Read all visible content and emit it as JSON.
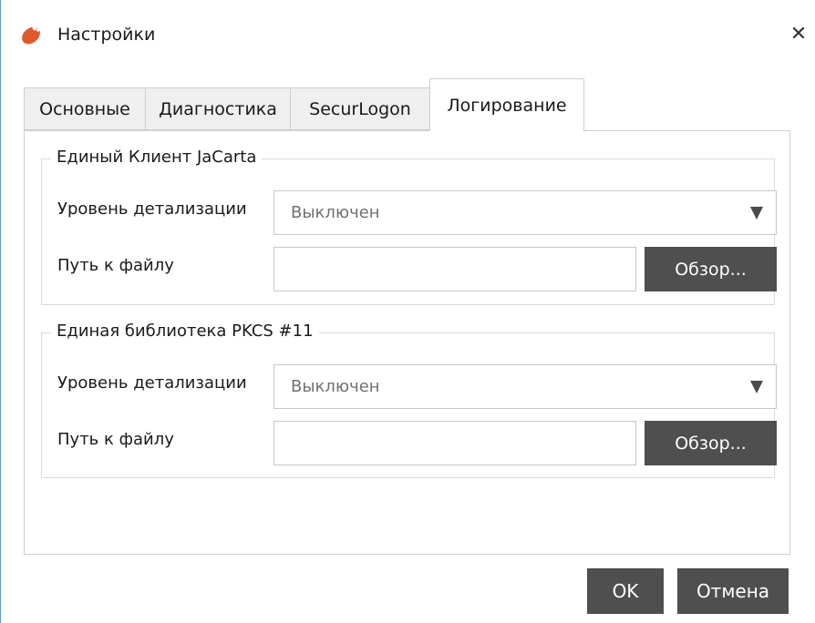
{
  "window": {
    "title": "Настройки",
    "app_icon": "jacarta-logo-icon",
    "close_icon": "close-icon",
    "close_glyph": "✕"
  },
  "tabs": [
    {
      "label": "Основные",
      "active": false
    },
    {
      "label": "Диагностика",
      "active": false
    },
    {
      "label": "SecurLogon",
      "active": false
    },
    {
      "label": "Логирование",
      "active": true
    }
  ],
  "groups": [
    {
      "title": "Единый Клиент JaCarta",
      "level_label": "Уровень детализации",
      "level_value": "Выключен",
      "path_label": "Путь к файлу",
      "path_value": "",
      "browse_label": "Обзор..."
    },
    {
      "title": "Единая библиотека PKCS #11",
      "level_label": "Уровень детализации",
      "level_value": "Выключен",
      "path_label": "Путь к файлу",
      "path_value": "",
      "browse_label": "Обзор..."
    }
  ],
  "footer": {
    "ok_label": "OK",
    "cancel_label": "Отмена"
  },
  "colors": {
    "button_bg": "#4f4f4f",
    "button_text": "#ffffff",
    "accent_logo": "#e05a2b",
    "window_border": "#5b9bd5"
  }
}
